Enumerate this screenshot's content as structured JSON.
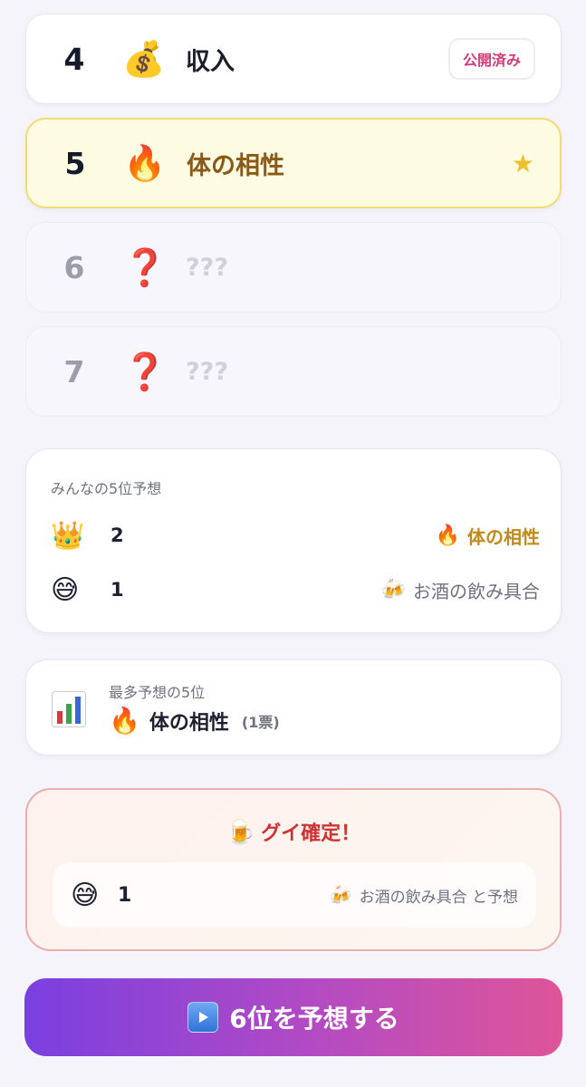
{
  "ranks": [
    {
      "number": "4",
      "emoji": "💰",
      "label": "収入",
      "badge": "公開済み"
    },
    {
      "number": "5",
      "emoji": "🔥",
      "label": "体の相性",
      "star": "★"
    },
    {
      "number": "6",
      "emoji": "❓",
      "label": "???"
    },
    {
      "number": "7",
      "emoji": "❓",
      "label": "???"
    }
  ],
  "predictions": {
    "title": "みんなの5位予想",
    "rows": [
      {
        "emoji": "👑",
        "count": "2",
        "item_icon": "🔥",
        "item": "体の相性"
      },
      {
        "emoji": "😅",
        "count": "1",
        "item_icon": "🍻",
        "item": "お酒の飲み具合"
      }
    ]
  },
  "most_predicted": {
    "label": "最多予想の5位",
    "emoji": "🔥",
    "value": "体の相性",
    "votes": "(1票)",
    "icon": "bar-chart-icon"
  },
  "guy_confirmed": {
    "emoji": "🍺",
    "title": "グイ確定！",
    "emoji_row": "😅",
    "count": "1",
    "item_icon": "🍻",
    "item": "お酒の飲み具合 と予想"
  },
  "cta": {
    "label": "6位を予想する",
    "icon": "play-icon"
  },
  "colors": {
    "highlight_bg": "#fefbe3",
    "highlight_border": "#f2dc72",
    "badge_text": "#d23a78",
    "accent_gold": "#c28a1d",
    "alert_red": "#cf3232",
    "cta_start": "#7a3fe0",
    "cta_end": "#de5598"
  }
}
